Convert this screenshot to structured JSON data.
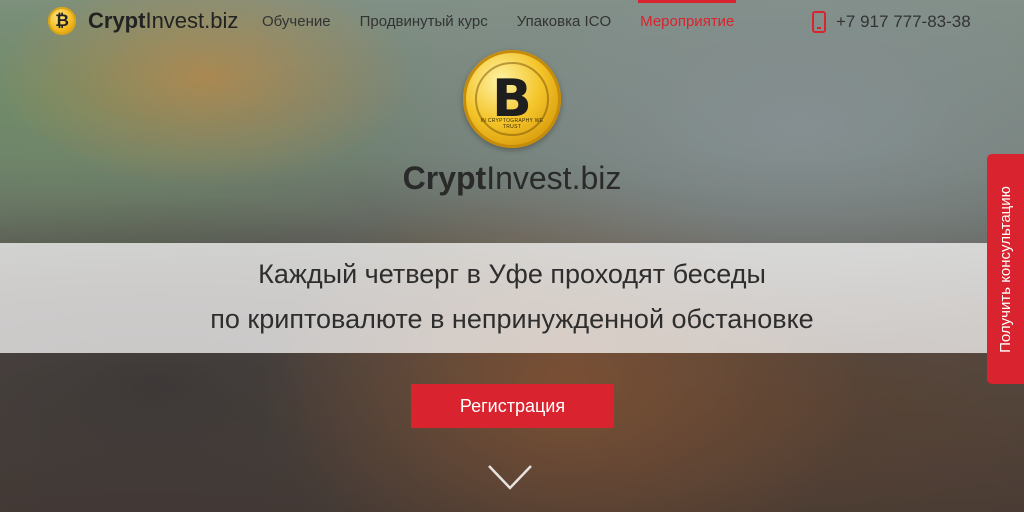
{
  "header": {
    "logo_coin_symbol": "₿",
    "logo_bold": "Crypt",
    "logo_rest": "Invest.biz",
    "nav": [
      {
        "label": "Обучение"
      },
      {
        "label": "Продвинутый курс"
      },
      {
        "label": "Упаковка ICO"
      },
      {
        "label": "Мероприятие",
        "active": true
      }
    ],
    "phone": "+7 917 777-83-38"
  },
  "hero": {
    "coin_symbol": "B",
    "coin_caption": "IN CRYPTOGRAPHY WE TRUST",
    "brand_bold": "Crypt",
    "brand_rest": "Invest.biz",
    "tagline_line1": "Каждый четверг в Уфе проходят беседы",
    "tagline_line2": "по криптовалюте в непринужденной обстановке",
    "register_label": "Регистрация"
  },
  "side_tab": {
    "label": "Получить консультацию"
  },
  "colors": {
    "accent": "#d9232e",
    "coin_gold": "#f4c52a"
  },
  "icons": [
    "bitcoin-icon",
    "phone-icon",
    "chevron-down-icon"
  ]
}
